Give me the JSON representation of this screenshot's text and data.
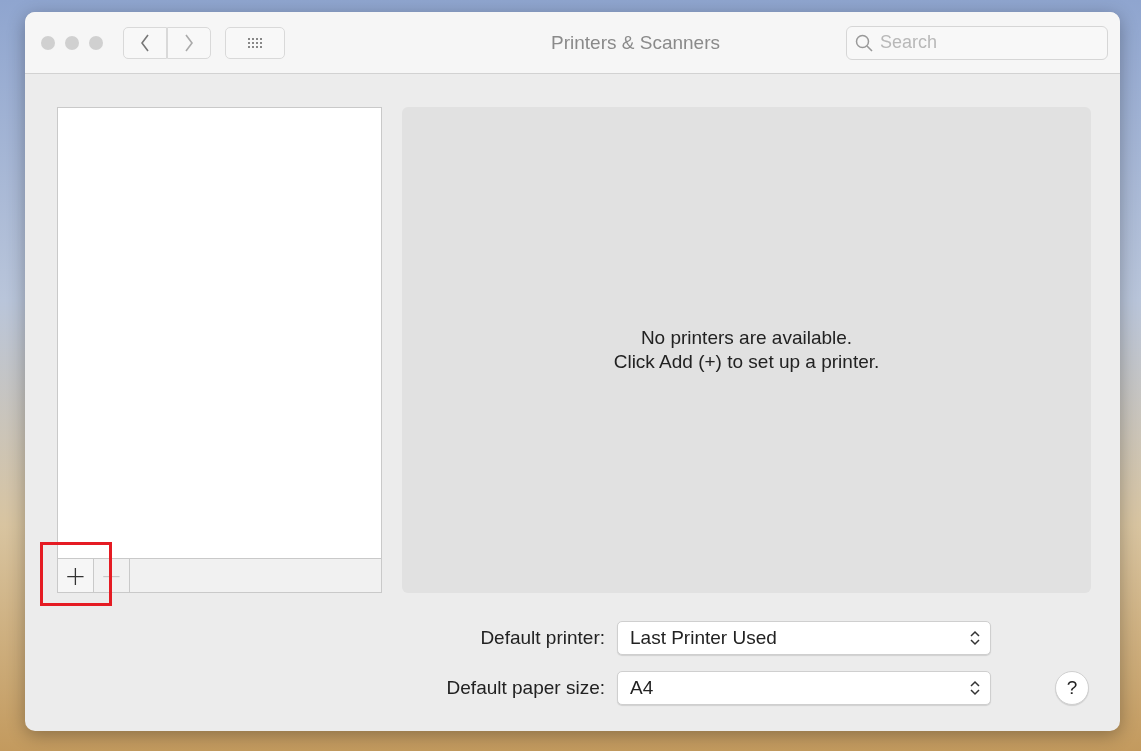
{
  "window": {
    "title": "Printers & Scanners",
    "search": {
      "placeholder": "Search"
    }
  },
  "printer_list": {
    "add_button": "+",
    "remove_button": "−",
    "remove_disabled": true,
    "highlighted": true
  },
  "message": {
    "lines": [
      "No printers are available.",
      "Click Add (+) to set up a printer."
    ]
  },
  "settings": [
    {
      "label": "Default printer:",
      "value": "Last Printer Used"
    },
    {
      "label": "Default paper size:",
      "value": "A4"
    }
  ],
  "help_button": "?"
}
